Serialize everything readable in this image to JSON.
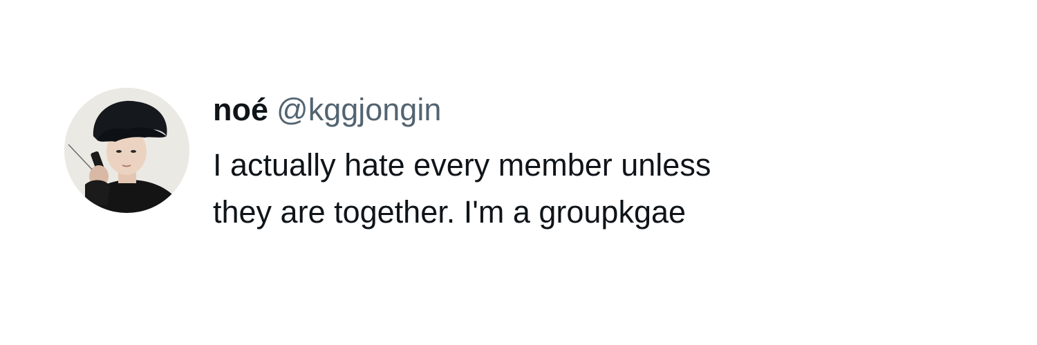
{
  "tweet": {
    "display_name": "noé",
    "handle": "@kggjongin",
    "text": "I actually hate every member unless\nthey are together. I'm a groupkgae",
    "avatar_icon": "profile-photo"
  },
  "colors": {
    "name": "#0f1419",
    "handle": "#536471",
    "background": "#ffffff"
  }
}
